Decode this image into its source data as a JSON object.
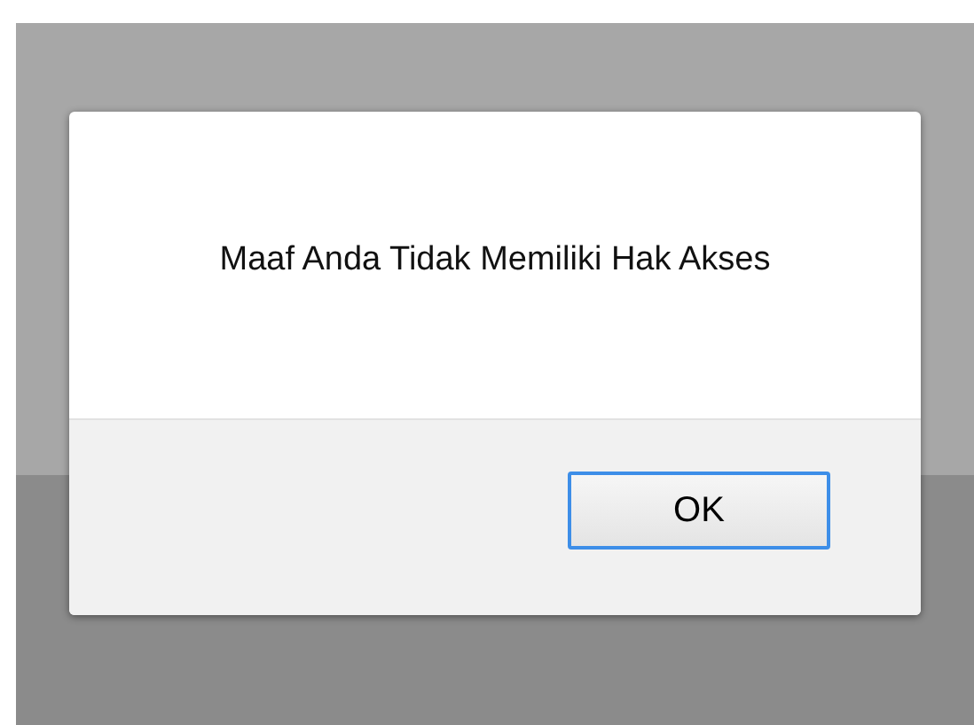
{
  "dialog": {
    "message": "Maaf Anda Tidak Memiliki Hak Akses",
    "buttons": [
      {
        "label": "OK",
        "focused": true
      }
    ]
  }
}
